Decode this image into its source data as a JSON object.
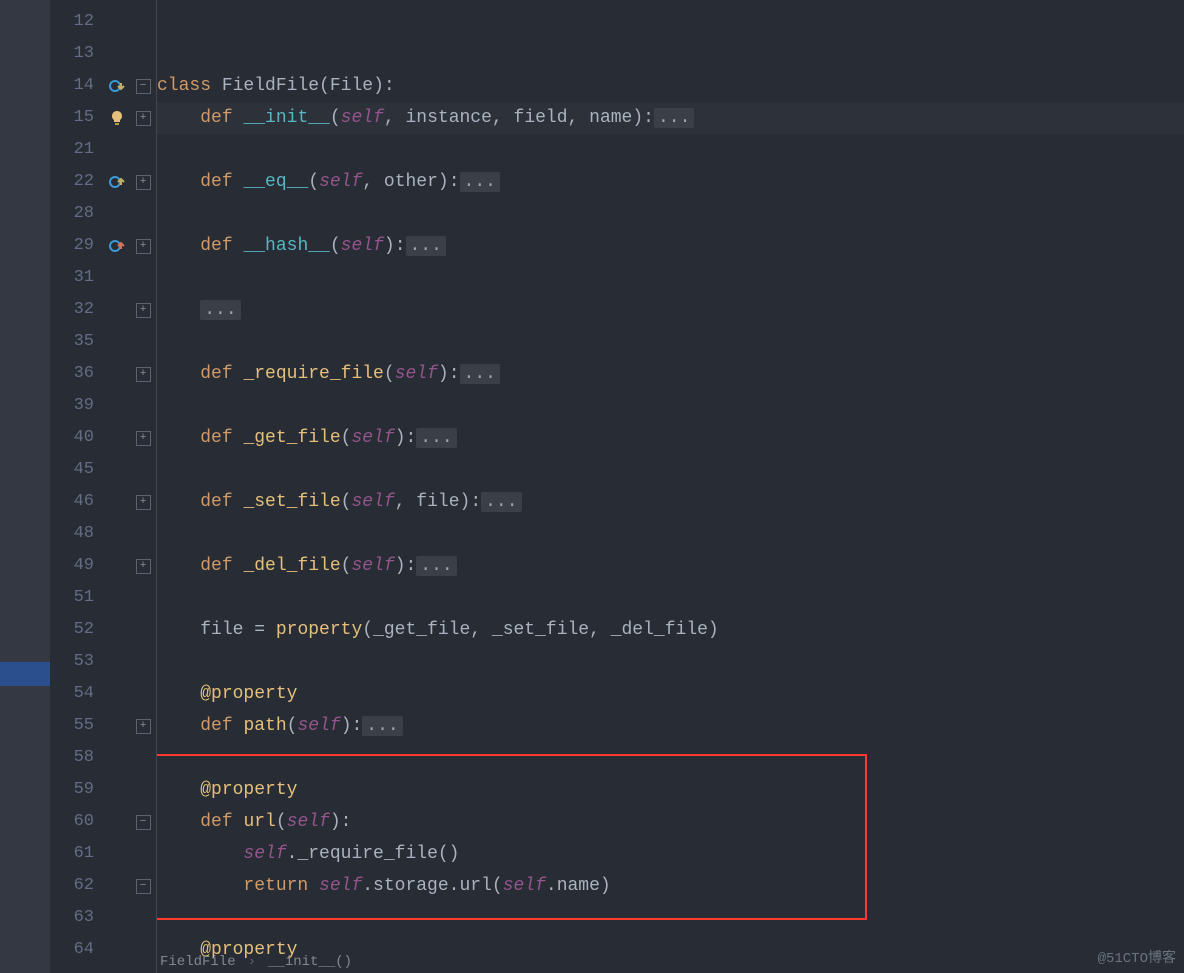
{
  "line_numbers": [
    "12",
    "13",
    "14",
    "15",
    "21",
    "22",
    "28",
    "29",
    "31",
    "32",
    "35",
    "36",
    "39",
    "40",
    "45",
    "46",
    "48",
    "49",
    "51",
    "52",
    "53",
    "54",
    "55",
    "58",
    "59",
    "60",
    "61",
    "62",
    "63",
    "64"
  ],
  "code": {
    "class_kw": "class",
    "class_name": " FieldFile",
    "class_base": "File",
    "def_kw": "def",
    "init_name": "__init__",
    "init_params": "(self, instance, field, name):",
    "eq_name": "__eq__",
    "eq_params": "(self, other):",
    "hash_name": "__hash__",
    "hash_params": "(self):",
    "req_name": "_require_file",
    "req_params": "(self):",
    "get_name": "_get_file",
    "get_params": "(self):",
    "set_name": "_set_file",
    "set_params": "(self, file):",
    "del_name": "_del_file",
    "del_params": "(self):",
    "file_assign_lhs": "file = ",
    "property_fn": "property",
    "file_assign_args": "(_get_file, _set_file, _del_file)",
    "decorator": "@property",
    "path_name": "path",
    "path_params": "(self):",
    "url_name": "url",
    "url_params": "(self):",
    "url_body1_self": "self",
    "url_body1_rest": "._require_file()",
    "return_kw": "return",
    "url_body2_self": " self",
    "url_body2_mid": ".storage.url(",
    "url_body2_self2": "self",
    "url_body2_end": ".name)",
    "ellipsis": "..."
  },
  "breadcrumb": {
    "file": "FieldFile",
    "sep": "›",
    "method": "__init__()"
  },
  "watermark": "@51CTO博客"
}
